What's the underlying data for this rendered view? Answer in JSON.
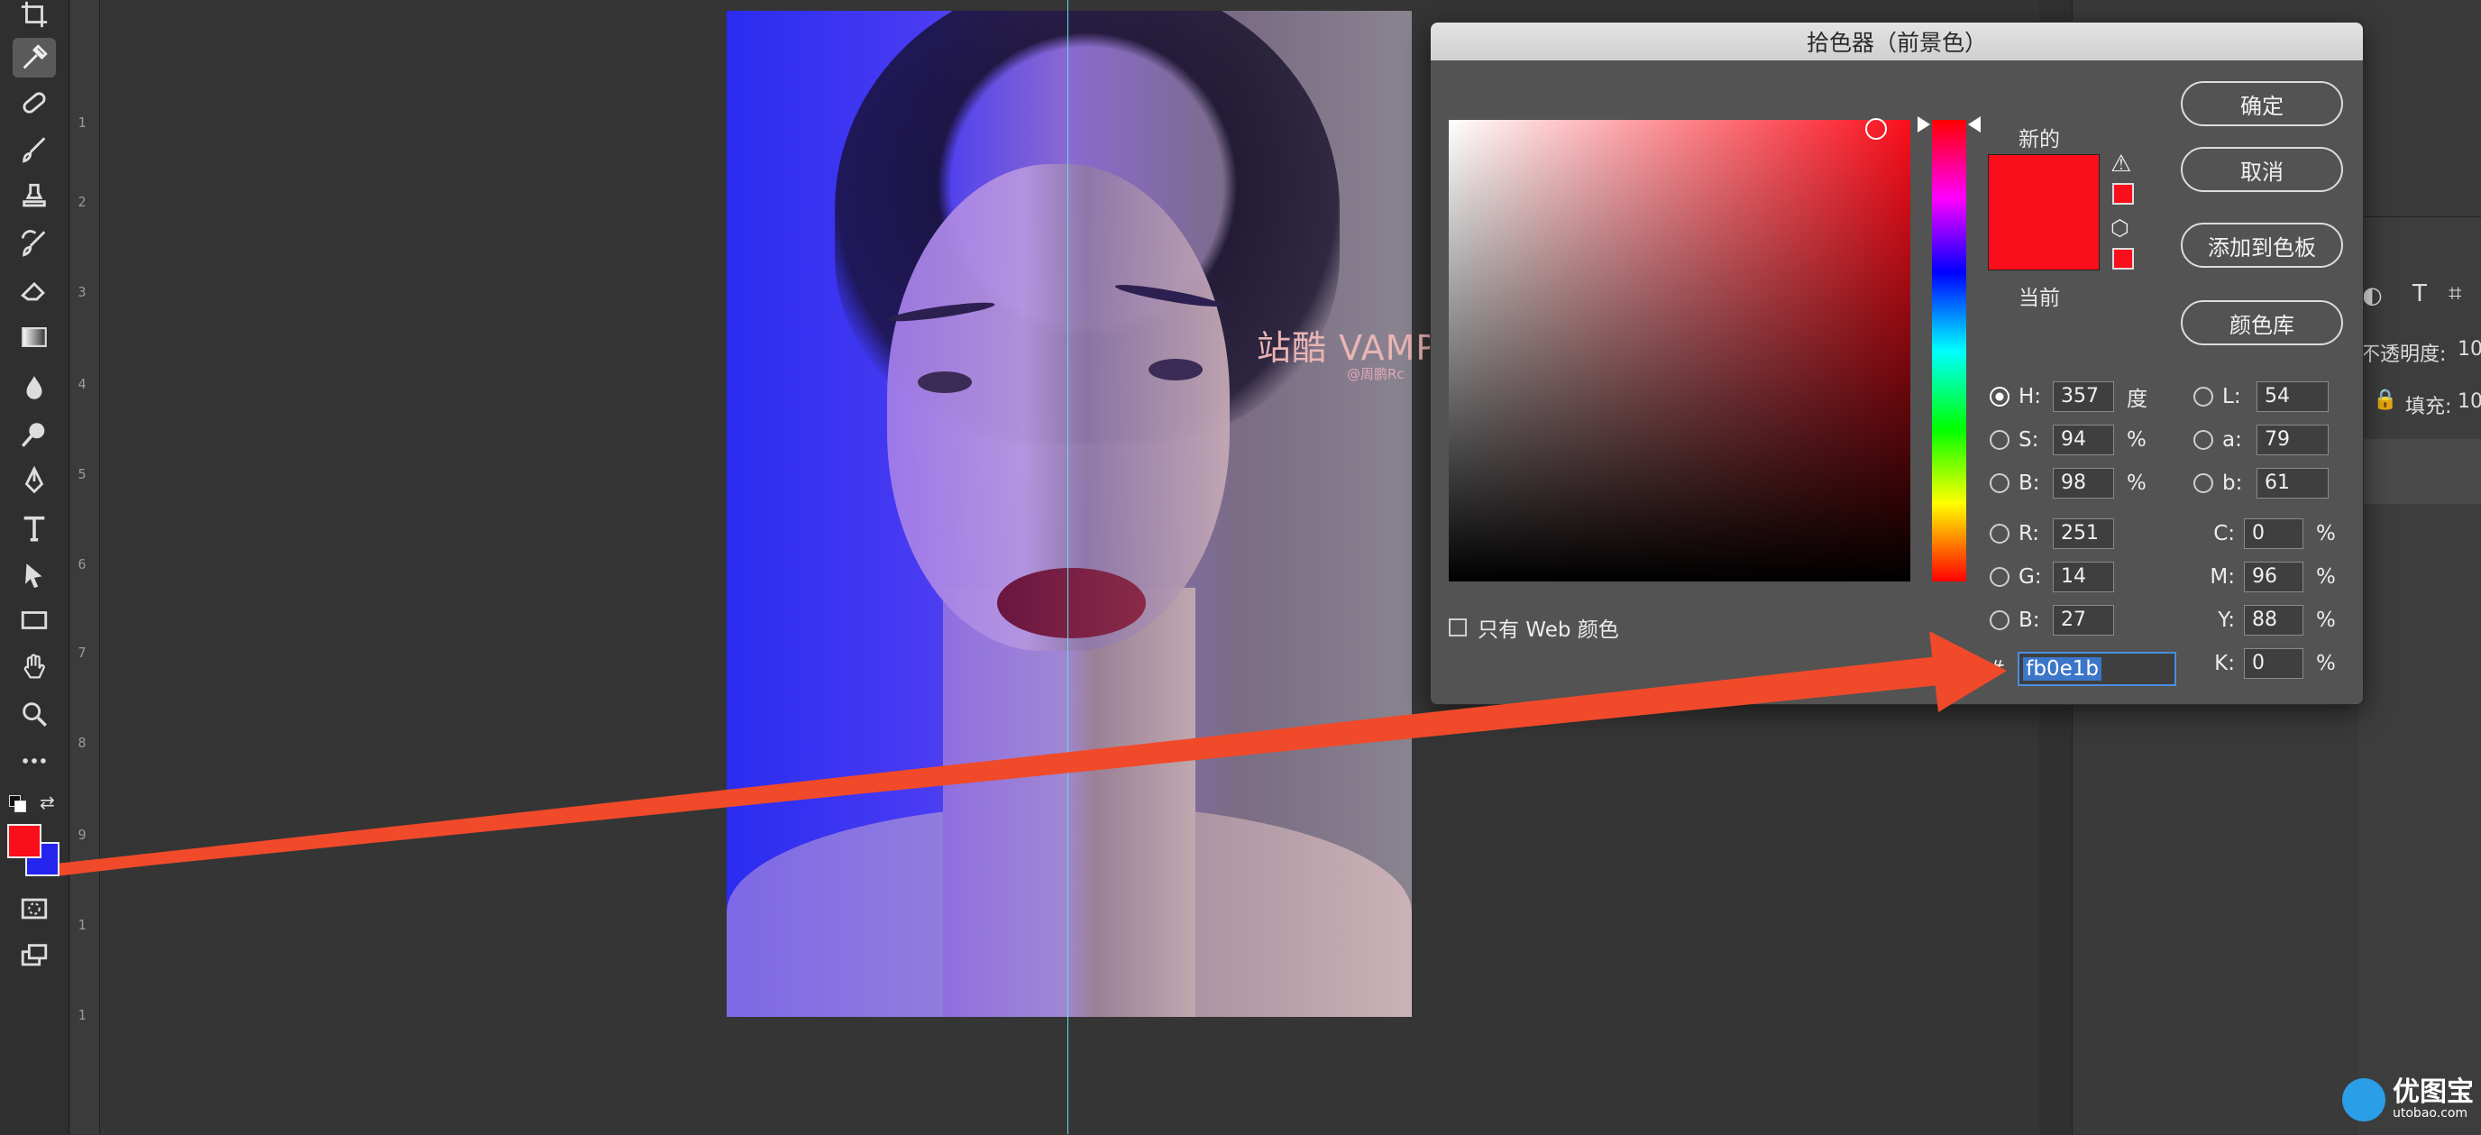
{
  "dialog": {
    "title": "拾色器（前景色）",
    "new_label": "新的",
    "current_label": "当前",
    "buttons": {
      "ok": "确定",
      "cancel": "取消",
      "add_swatch": "添加到色板",
      "color_library": "颜色库"
    },
    "web_only_label": "只有 Web 颜色",
    "fields": {
      "H": {
        "label": "H:",
        "value": "357",
        "unit": "度"
      },
      "S": {
        "label": "S:",
        "value": "94",
        "unit": "%"
      },
      "Bv": {
        "label": "B:",
        "value": "98",
        "unit": "%"
      },
      "R": {
        "label": "R:",
        "value": "251"
      },
      "G": {
        "label": "G:",
        "value": "14"
      },
      "Bc": {
        "label": "B:",
        "value": "27"
      },
      "L": {
        "label": "L:",
        "value": "54"
      },
      "a": {
        "label": "a:",
        "value": "79"
      },
      "b": {
        "label": "b:",
        "value": "61"
      },
      "C": {
        "label": "C:",
        "value": "0",
        "unit": "%"
      },
      "M": {
        "label": "M:",
        "value": "96",
        "unit": "%"
      },
      "Y": {
        "label": "Y:",
        "value": "88",
        "unit": "%"
      },
      "K": {
        "label": "K:",
        "value": "0",
        "unit": "%"
      }
    },
    "hash": "#",
    "hex": "fb0e1b",
    "selected_color": "#fb0e1b"
  },
  "canvas": {
    "watermark": "站酷 VAMPIREE",
    "watermark_sub": "@周鹏Rc"
  },
  "ruler": {
    "ticks": [
      "1",
      "2",
      "3",
      "4",
      "5",
      "6",
      "7",
      "8",
      "9",
      "1",
      "1"
    ]
  },
  "swatches": {
    "foreground": "#fb0e1b",
    "background": "#2424ee"
  },
  "right_panel": {
    "opacity_label": "不透明度:",
    "opacity_value": "10",
    "fill_label": "填充:",
    "fill_value": "10"
  },
  "logo": {
    "name": "优图宝",
    "url": "utobao.com"
  },
  "annotation_color": "#f04a2a"
}
